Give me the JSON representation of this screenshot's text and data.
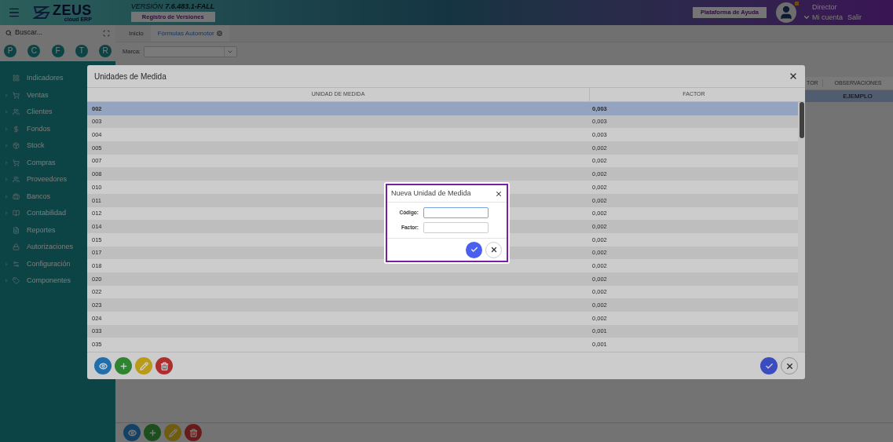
{
  "header": {
    "logo": "ZEUS",
    "logo_sub": "cloud ERP",
    "version_label": "VERSIÓN",
    "version": "7.6.483.1-FALL",
    "versions_button": "Registro de Versiones",
    "help_button": "Plataforma de Ayuda",
    "user": {
      "role": "Director",
      "account_link": "Mi cuenta",
      "logout_link": "Salir"
    }
  },
  "sidebar": {
    "search_placeholder": "Buscar...",
    "shortcuts": [
      "P",
      "C",
      "F",
      "T",
      "R"
    ],
    "items": [
      {
        "label": "Indicadores",
        "expandable": false
      },
      {
        "label": "Ventas",
        "expandable": true
      },
      {
        "label": "Clientes",
        "expandable": true
      },
      {
        "label": "Fondos",
        "expandable": true
      },
      {
        "label": "Stock",
        "expandable": true
      },
      {
        "label": "Compras",
        "expandable": true
      },
      {
        "label": "Proveedores",
        "expandable": true
      },
      {
        "label": "Bancos",
        "expandable": true
      },
      {
        "label": "Contabilidad",
        "expandable": true
      },
      {
        "label": "Reportes",
        "expandable": false
      },
      {
        "label": "Autorizaciones",
        "expandable": false
      },
      {
        "label": "Configuración",
        "expandable": true
      },
      {
        "label": "Componentes",
        "expandable": true
      }
    ]
  },
  "tabs": [
    {
      "label": "Inicio",
      "selected": false,
      "closable": false
    },
    {
      "label": "Fórmulas Automotor",
      "selected": true,
      "closable": true
    }
  ],
  "filter": {
    "label": "Marca:"
  },
  "background_table": {
    "columns": [
      "TOR",
      "OBSERVACIONES"
    ],
    "rows": [
      {
        "cells": [
          "",
          "EJEMPLO"
        ],
        "selected": true
      }
    ]
  },
  "modal": {
    "title": "Unidades de Medida",
    "columns": [
      "UNIDAD DE MEDIDA",
      "FACTOR"
    ],
    "rows": [
      {
        "code": "002",
        "factor": "0,003",
        "selected": true
      },
      {
        "code": "003",
        "factor": "0,003",
        "selected": false
      },
      {
        "code": "004",
        "factor": "0,003",
        "selected": false
      },
      {
        "code": "005",
        "factor": "0,002",
        "selected": false
      },
      {
        "code": "007",
        "factor": "0,002",
        "selected": false
      },
      {
        "code": "008",
        "factor": "0,002",
        "selected": false
      },
      {
        "code": "010",
        "factor": "0,002",
        "selected": false
      },
      {
        "code": "011",
        "factor": "0,002",
        "selected": false
      },
      {
        "code": "012",
        "factor": "0,002",
        "selected": false
      },
      {
        "code": "014",
        "factor": "0,002",
        "selected": false
      },
      {
        "code": "015",
        "factor": "0,002",
        "selected": false
      },
      {
        "code": "017",
        "factor": "0,002",
        "selected": false
      },
      {
        "code": "018",
        "factor": "0,002",
        "selected": false
      },
      {
        "code": "020",
        "factor": "0,002",
        "selected": false
      },
      {
        "code": "022",
        "factor": "0,002",
        "selected": false
      },
      {
        "code": "023",
        "factor": "0,002",
        "selected": false
      },
      {
        "code": "024",
        "factor": "0,002",
        "selected": false
      },
      {
        "code": "033",
        "factor": "0,001",
        "selected": false
      },
      {
        "code": "035",
        "factor": "0,001",
        "selected": false
      }
    ]
  },
  "dialog": {
    "title": "Nueva Unidad de Medida",
    "fields": [
      {
        "label": "Código:",
        "focused": true
      },
      {
        "label": "Factor:",
        "focused": false
      }
    ]
  }
}
